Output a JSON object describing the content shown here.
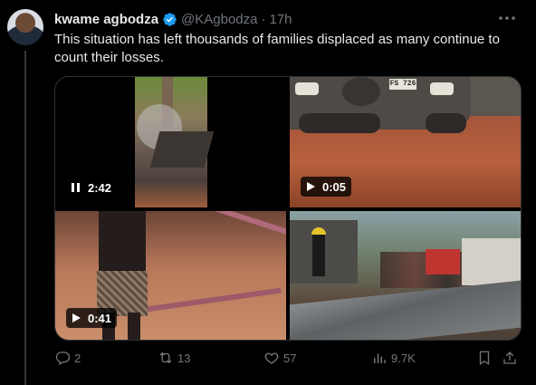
{
  "tweet": {
    "author_name": "kwame agbodza",
    "handle": "@KAgbodza",
    "separator": "·",
    "time": "17h",
    "text": "This situation has left thousands of families displaced as many continue to count their losses."
  },
  "media": [
    {
      "duration": "2:42",
      "state": "paused"
    },
    {
      "duration": "0:05",
      "state": "play"
    },
    {
      "duration": "0:41",
      "state": "play"
    },
    {
      "duration": "",
      "state": "image"
    }
  ],
  "plate_text": "FS 726",
  "actions": {
    "replies": "2",
    "reposts": "13",
    "likes": "57",
    "views": "9.7K"
  },
  "colors": {
    "verified": "#1d9bf0",
    "muted": "#71767b",
    "background": "#000000"
  },
  "icons": [
    "verified-icon",
    "more-icon",
    "pause-icon",
    "play-icon",
    "reply-icon",
    "repost-icon",
    "like-icon",
    "views-icon",
    "bookmark-icon",
    "share-icon"
  ]
}
